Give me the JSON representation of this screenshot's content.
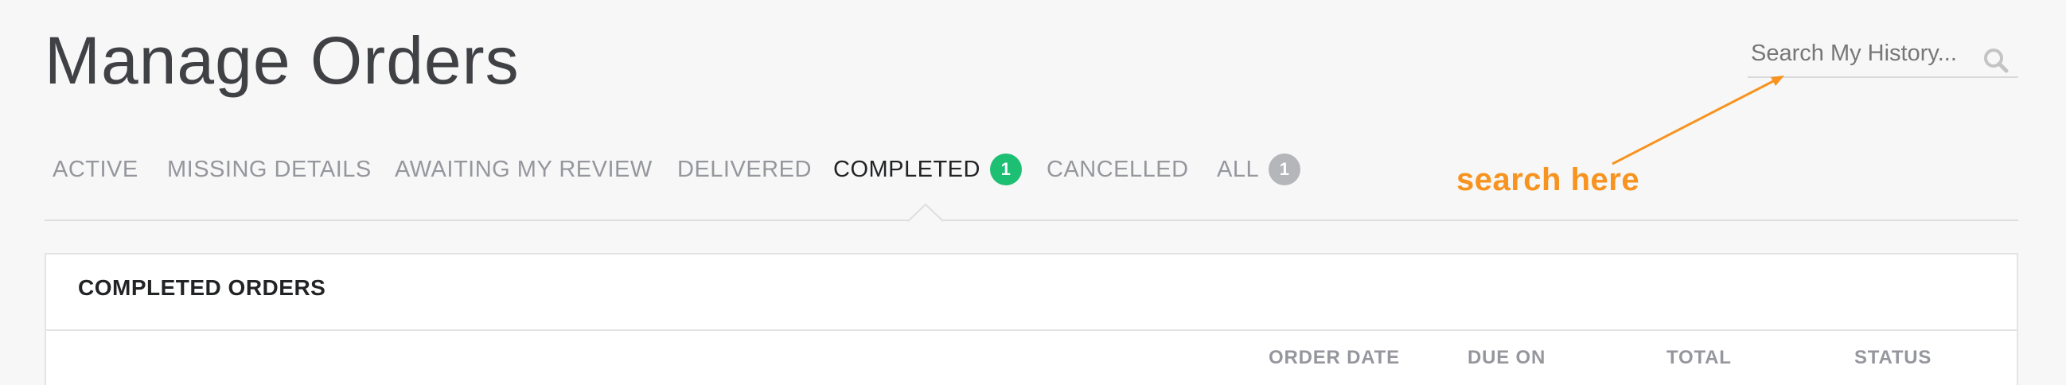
{
  "header": {
    "title": "Manage Orders"
  },
  "search": {
    "placeholder": "Search My History..."
  },
  "tabs": [
    {
      "label": "ACTIVE"
    },
    {
      "label": "MISSING DETAILS"
    },
    {
      "label": "AWAITING MY REVIEW"
    },
    {
      "label": "DELIVERED"
    },
    {
      "label": "COMPLETED",
      "badge": "1",
      "active": true
    },
    {
      "label": "CANCELLED"
    },
    {
      "label": "ALL",
      "badge": "1"
    }
  ],
  "annotation": {
    "text": "search here",
    "color": "#f7931e"
  },
  "panel": {
    "title": "COMPLETED ORDERS",
    "columns": [
      "ORDER DATE",
      "DUE ON",
      "TOTAL",
      "STATUS"
    ]
  },
  "colors": {
    "badge_green": "#1dbf73",
    "badge_grey": "#b5b6ba",
    "active_tab": "#222325",
    "inactive_tab": "#95979d"
  }
}
